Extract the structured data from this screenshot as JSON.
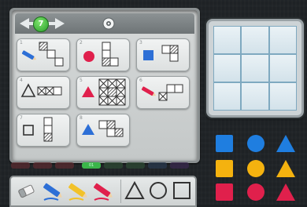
{
  "level": {
    "number": "7"
  },
  "puzzles": [
    {
      "id": "1",
      "tool": "pen",
      "tool_color": "#2d6fd6"
    },
    {
      "id": "2",
      "shape": "circle",
      "color": "#e0204c"
    },
    {
      "id": "3",
      "shape": "square",
      "color": "#2d6fd6"
    },
    {
      "id": "4",
      "shape": "triangle-outline",
      "color": "#3a3a3a"
    },
    {
      "id": "5",
      "shape": "triangle",
      "color": "#e0204c"
    },
    {
      "id": "6",
      "tool": "pen",
      "tool_color": "#e0204c"
    },
    {
      "id": "7",
      "shape": "square-outline",
      "color": "#3a3a3a"
    },
    {
      "id": "8",
      "shape": "triangle",
      "color": "#2d6fd6"
    }
  ],
  "pages": {
    "selected_index": 4,
    "count": 9,
    "selected_label": "01"
  },
  "tools": [
    {
      "name": "eraser-icon"
    },
    {
      "name": "blue-pen-icon",
      "color": "#2d6fd6"
    },
    {
      "name": "yellow-pen-icon",
      "color": "#f2c22a"
    },
    {
      "name": "red-pen-icon",
      "color": "#e0204c"
    },
    {
      "name": "triangle-outline-icon"
    },
    {
      "name": "circle-outline-icon"
    },
    {
      "name": "square-outline-icon"
    }
  ],
  "target_board": {
    "rows": 3,
    "cols": 3
  },
  "palette": {
    "colors": [
      "#1f7ee0",
      "#f4b20f",
      "#e0204c"
    ],
    "shapes": [
      "square",
      "circle",
      "triangle"
    ]
  }
}
